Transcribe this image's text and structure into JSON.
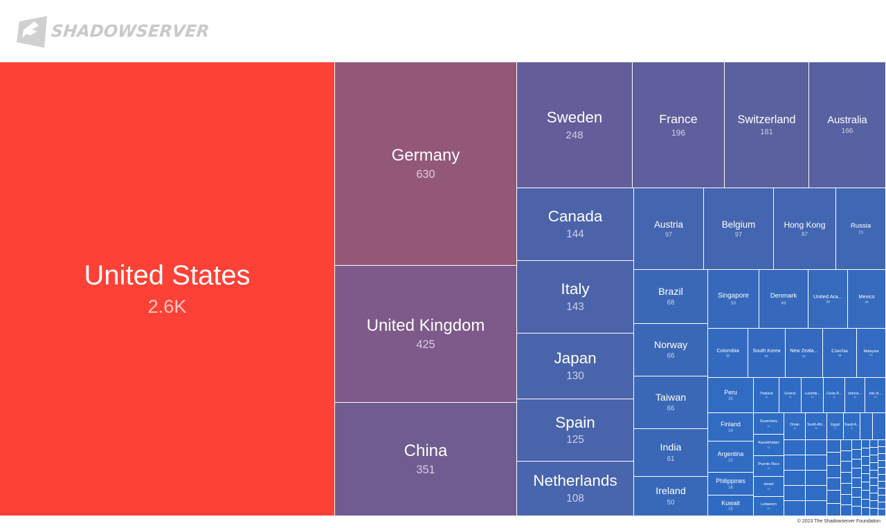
{
  "logo": {
    "text": "SHADOWSERVER"
  },
  "footer": "© 2023 The Shadowserver Foundation",
  "chart_data": {
    "type": "treemap",
    "items": [
      {
        "name": "United States",
        "label": "2.6K",
        "value": 2600,
        "color": "#fd4136"
      },
      {
        "name": "Germany",
        "label": "630",
        "value": 630,
        "color": "#935878"
      },
      {
        "name": "United Kingdom",
        "label": "425",
        "value": 425,
        "color": "#7d5a8a"
      },
      {
        "name": "China",
        "label": "351",
        "value": 351,
        "color": "#6f5c91"
      },
      {
        "name": "Sweden",
        "label": "248",
        "value": 248,
        "color": "#635d9a"
      },
      {
        "name": "France",
        "label": "196",
        "value": 196,
        "color": "#5f5f9d"
      },
      {
        "name": "Switzerland",
        "label": "181",
        "value": 181,
        "color": "#5b609f"
      },
      {
        "name": "Australia",
        "label": "166",
        "value": 166,
        "color": "#5861a2"
      },
      {
        "name": "Canada",
        "label": "144",
        "value": 144,
        "color": "#4c63a9"
      },
      {
        "name": "Italy",
        "label": "143",
        "value": 143,
        "color": "#4c63a9"
      },
      {
        "name": "Japan",
        "label": "130",
        "value": 130,
        "color": "#4a64ab"
      },
      {
        "name": "Spain",
        "label": "125",
        "value": 125,
        "color": "#4a64ab"
      },
      {
        "name": "Netherlands",
        "label": "108",
        "value": 108,
        "color": "#4865ad"
      },
      {
        "name": "Austria",
        "label": "97",
        "value": 97,
        "color": "#4465af"
      },
      {
        "name": "Belgium",
        "label": "97",
        "value": 97,
        "color": "#4465af"
      },
      {
        "name": "Hong Kong",
        "label": "87",
        "value": 87,
        "color": "#4266b1"
      },
      {
        "name": "Russia",
        "label": "70",
        "value": 70,
        "color": "#3f67b3"
      },
      {
        "name": "Brazil",
        "label": "68",
        "value": 68,
        "color": "#3b68b6"
      },
      {
        "name": "Norway",
        "label": "66",
        "value": 66,
        "color": "#3b68b6"
      },
      {
        "name": "Taiwan",
        "label": "66",
        "value": 66,
        "color": "#3b68b6"
      },
      {
        "name": "India",
        "label": "61",
        "value": 61,
        "color": "#3a68b7"
      },
      {
        "name": "Ireland",
        "label": "50",
        "value": 50,
        "color": "#3869b9"
      },
      {
        "name": "Singapore",
        "label": "50",
        "value": 50,
        "color": "#3669bb"
      },
      {
        "name": "Denmark",
        "label": "49",
        "value": 49,
        "color": "#3669bb"
      },
      {
        "name": "United Ara...",
        "label": "39",
        "value": 39,
        "color": "#356abd"
      },
      {
        "name": "Mexico",
        "label": "38",
        "value": 38,
        "color": "#356abd"
      },
      {
        "name": "Colombia",
        "label": "32",
        "value": 32,
        "color": "#336ac0"
      },
      {
        "name": "South Korea",
        "label": "31",
        "value": 31,
        "color": "#336ac0"
      },
      {
        "name": "New Zeala...",
        "label": "31",
        "value": 31,
        "color": "#336ac0"
      },
      {
        "name": "Czechia",
        "label": "28",
        "value": 28,
        "color": "#336ac0"
      },
      {
        "name": "Malaysia",
        "label": "25",
        "value": 25,
        "color": "#326bc1"
      },
      {
        "name": "Peru",
        "label": "25",
        "value": 25,
        "color": "#316bc2"
      },
      {
        "name": "Thailand",
        "label": "13",
        "value": 13,
        "color": "#306bc3"
      },
      {
        "name": "Greece",
        "label": "13",
        "value": 13,
        "color": "#306bc3"
      },
      {
        "name": "Luxemb...",
        "label": "13",
        "value": 13,
        "color": "#306bc3"
      },
      {
        "name": "Costa R...",
        "label": "12",
        "value": 12,
        "color": "#306bc3"
      },
      {
        "name": "Indone...",
        "label": "12",
        "value": 12,
        "color": "#306bc3"
      },
      {
        "name": "Isle of...",
        "label": "12",
        "value": 12,
        "color": "#306bc3"
      },
      {
        "name": "Finland",
        "label": "24",
        "value": 24,
        "color": "#316bc2"
      },
      {
        "name": "Argentina",
        "label": "22",
        "value": 22,
        "color": "#316bc2"
      },
      {
        "name": "Philippines",
        "label": "16",
        "value": 16,
        "color": "#306bc3"
      },
      {
        "name": "Kuwait",
        "label": "15",
        "value": 15,
        "color": "#306bc3"
      },
      {
        "name": "Guernsey",
        "label": "11",
        "value": 11,
        "color": "#2f6cc4"
      },
      {
        "name": "Kazakhstan",
        "label": "11",
        "value": 11,
        "color": "#2f6cc4"
      },
      {
        "name": "Puerto Rico",
        "label": "11",
        "value": 11,
        "color": "#2f6cc4"
      },
      {
        "name": "Israel",
        "label": "10",
        "value": 10,
        "color": "#2f6cc4"
      },
      {
        "name": "Lebanon",
        "label": "10",
        "value": 10,
        "color": "#2f6cc4"
      },
      {
        "name": "Oman",
        "label": "10",
        "value": 10,
        "color": "#2f6cc4"
      },
      {
        "name": "South Afri...",
        "label": "10",
        "value": 10,
        "color": "#2f6cc4"
      },
      {
        "name": "Egypt",
        "label": "9",
        "value": 9,
        "color": "#2f6cc4"
      },
      {
        "name": "Saudi A...",
        "label": "9",
        "value": 9,
        "color": "#2f6cc4"
      }
    ],
    "filler_color": "#2e6cc5"
  }
}
